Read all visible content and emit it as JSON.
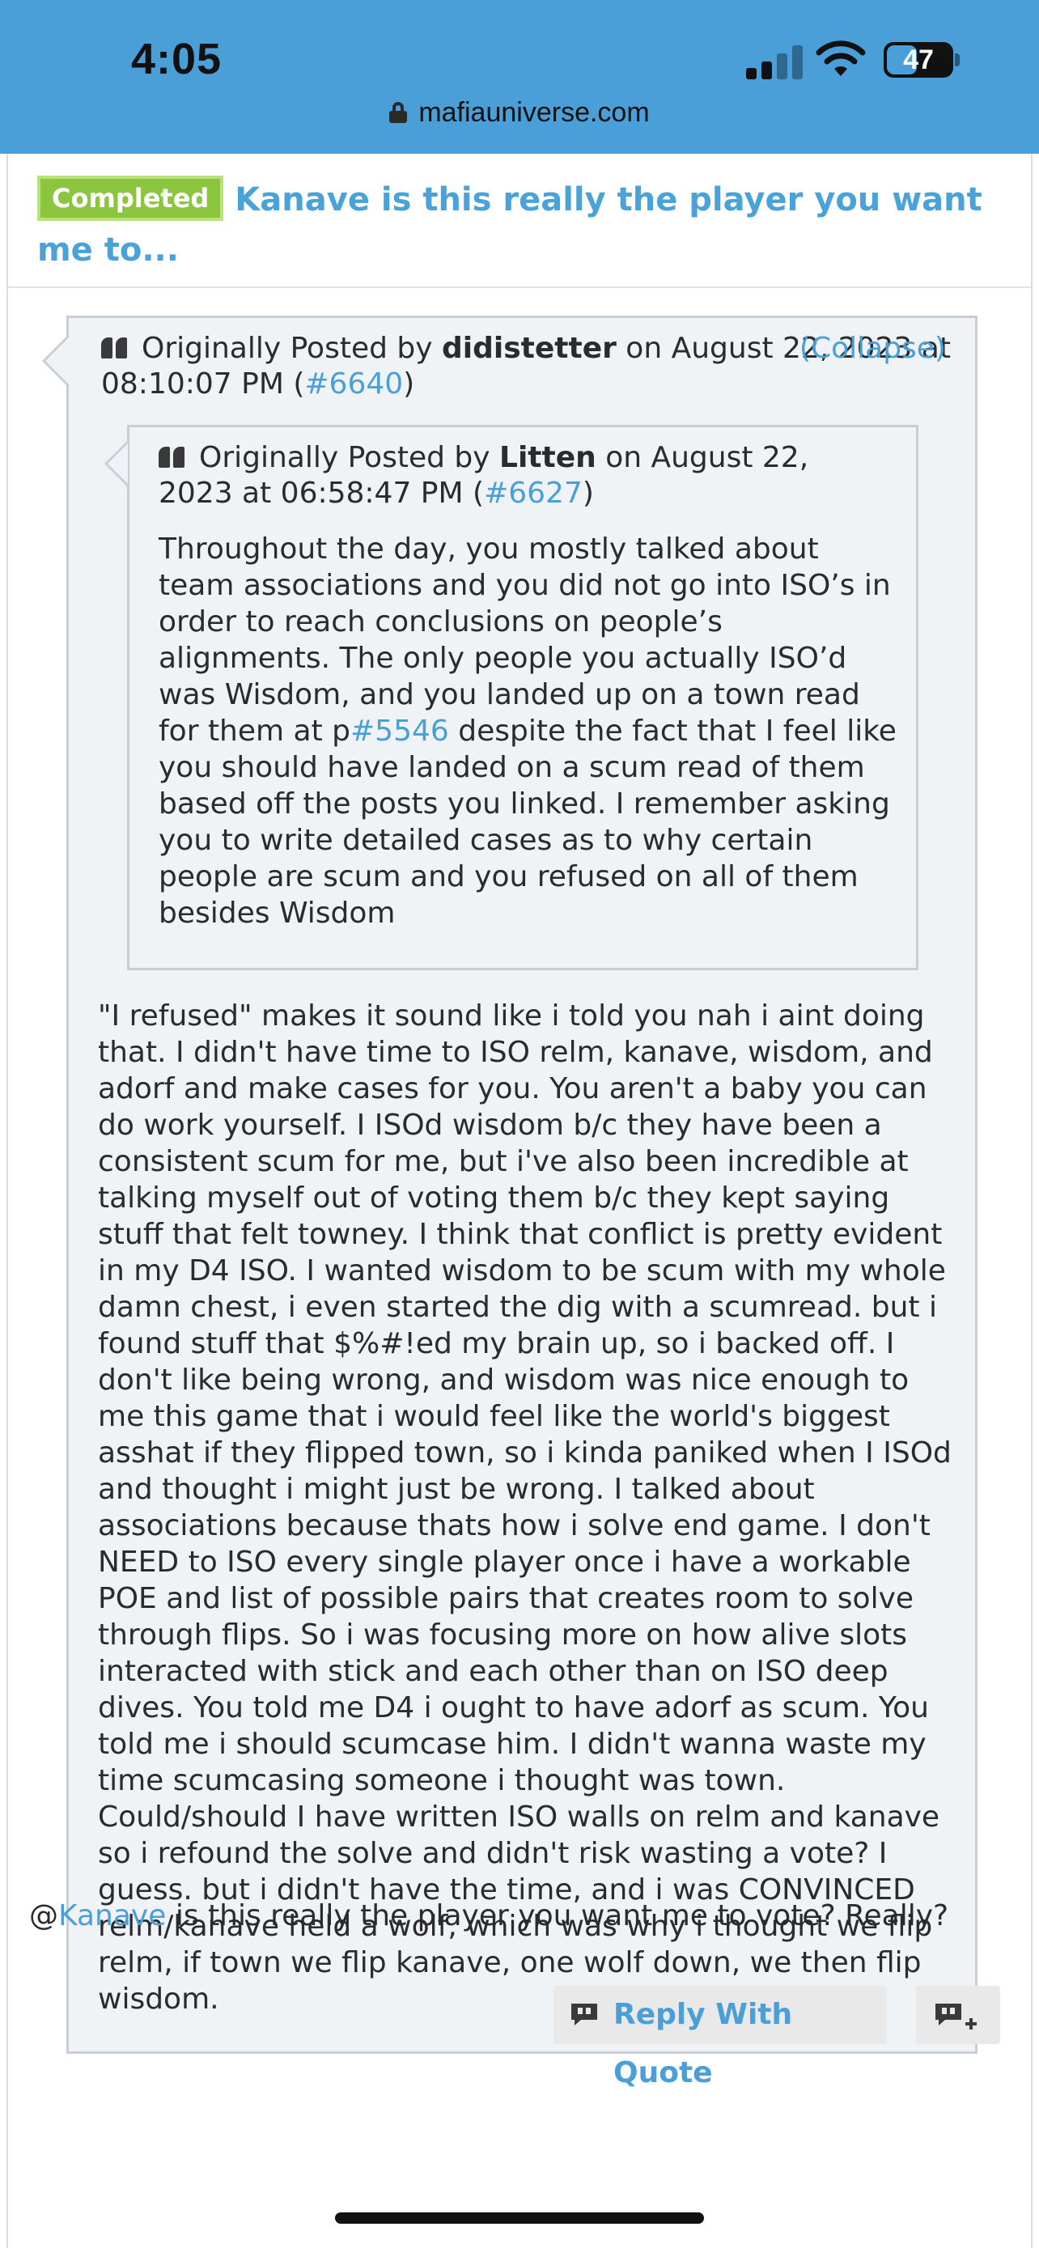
{
  "status_bar": {
    "time": "4:05",
    "battery": "47",
    "battery_level_percent": 47,
    "url": "mafiauniverse.com",
    "icons": [
      "signal-icon",
      "wifi-icon",
      "battery-icon",
      "lock-icon"
    ]
  },
  "thread": {
    "badge": "Completed",
    "title": "Kanave is this really the player you want me to..."
  },
  "outer_quote": {
    "prefix": "Originally Posted by ",
    "author": "didistetter",
    "date_text": " on August 22, 2023 at 08:10:07 PM (",
    "post_ref": "#6640",
    "close_paren": ")",
    "collapse_label": "(Collapse)",
    "body": "\"I refused\" makes it sound like i told you nah i aint doing that. I didn't have time to ISO relm, kanave, wisdom, and adorf and make cases for you. You aren't a baby you can do work yourself. I ISOd wisdom b/c they have been a consistent scum for me, but i've also been incredible at talking myself out of voting them b/c they kept saying stuff that felt towney. I think that conflict is pretty evident in my D4 ISO. I wanted wisdom to be scum with my whole damn chest, i even started the dig with a scumread. but i found stuff that $%#!ed my brain up, so i backed off. I don't like being wrong, and wisdom was nice enough to me this game that i would feel like the world's biggest asshat if they flipped town, so i kinda paniked when I ISOd and thought i might just be wrong. I talked about associations because thats how i solve end game. I don't NEED to ISO every single player once i have a workable POE and list of possible pairs that creates room to solve through flips. So i was focusing more on how alive slots interacted with stick and each other than on ISO deep dives. You told me D4 i ought to have adorf as scum. You told me i should scumcase him. I didn't wanna waste my time scumcasing someone i thought was town. Could/should I have written ISO walls on relm and kanave so i refound the solve and didn't risk wasting a vote? I guess. but i didn't have the time, and i was CONVINCED relm/kanave held a wolf, which was why i thought we flip relm, if town we flip kanave, one wolf down, we then flip wisdom."
  },
  "inner_quote": {
    "prefix": "Originally Posted by ",
    "author": "Litten",
    "date_text": " on August 22, 2023 at 06:58:47 PM (",
    "post_ref": "#6627",
    "close_paren": ")",
    "body_before_link": "Throughout the day, you mostly talked about team associations and you did not go into ISO’s in order to reach conclusions on people’s alignments. The only people you actually ISO’d was Wisdom, and you landed up on a town read for them at p",
    "body_link": "#5546",
    "body_after_link": " despite the fact that I feel like you should have landed on a scum read of them based off the posts you linked. I remember asking you to write detailed cases as to why certain people are scum and you refused on all of them besides Wisdom"
  },
  "reply": {
    "at": "@",
    "mention": "Kanave",
    "text": " is this really the player you want me to vote? Really?"
  },
  "buttons": {
    "reply_with_quote": "Reply With Quote"
  },
  "colors": {
    "header_blue": "#4a9fd8",
    "link_blue": "#4a9fd8",
    "badge_green": "#8cc63e",
    "quote_bg": "#eff3f6"
  }
}
